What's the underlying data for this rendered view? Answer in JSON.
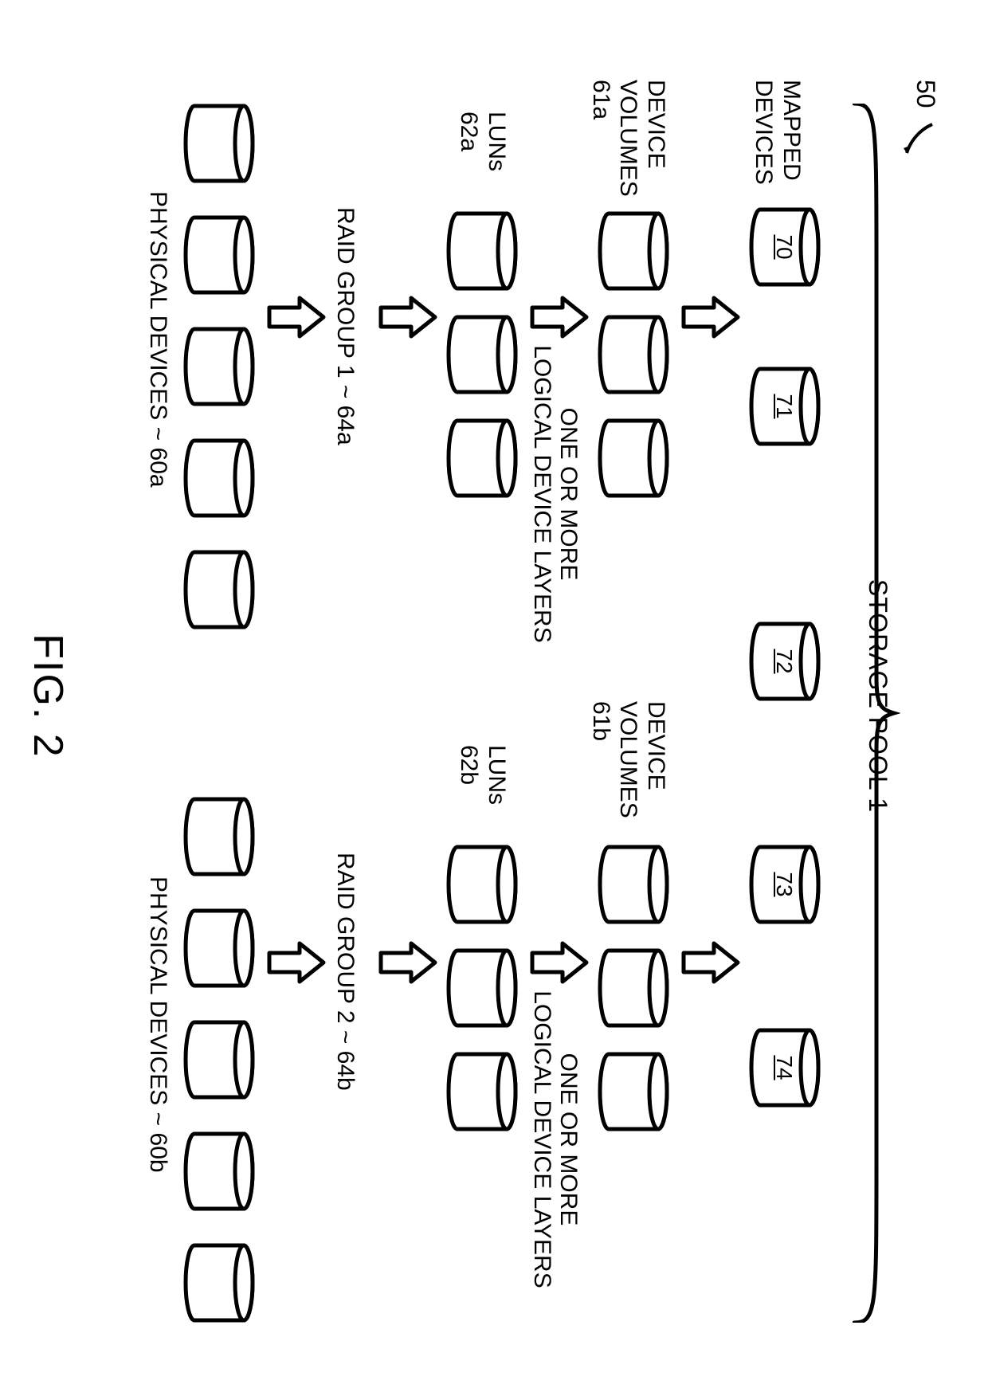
{
  "figure_ref": "50",
  "brace_title": "STORAGE POOL 1",
  "caption": "FIG. 2",
  "layers": {
    "mapped": {
      "label": "MAPPED\nDEVICES",
      "ids": [
        "70",
        "71",
        "72",
        "73",
        "74"
      ]
    },
    "device_volumes": {
      "label_left": "DEVICE\nVOLUMES\n61a",
      "label_right": "DEVICE\nVOLUMES\n61b"
    },
    "luns": {
      "label_left": "LUNs\n62a",
      "label_right": "LUNs\n62b"
    },
    "mid_text_left": "ONE OR MORE\nLOGICAL DEVICE LAYERS",
    "mid_text_right": "ONE OR MORE\nLOGICAL DEVICE LAYERS",
    "raid": {
      "left": "RAID GROUP 1 ~ 64a",
      "right": "RAID GROUP 2 ~ 64b"
    },
    "physical": {
      "left": "PHYSICAL DEVICES ~ 60a",
      "right": "PHYSICAL DEVICES ~ 60b"
    }
  }
}
